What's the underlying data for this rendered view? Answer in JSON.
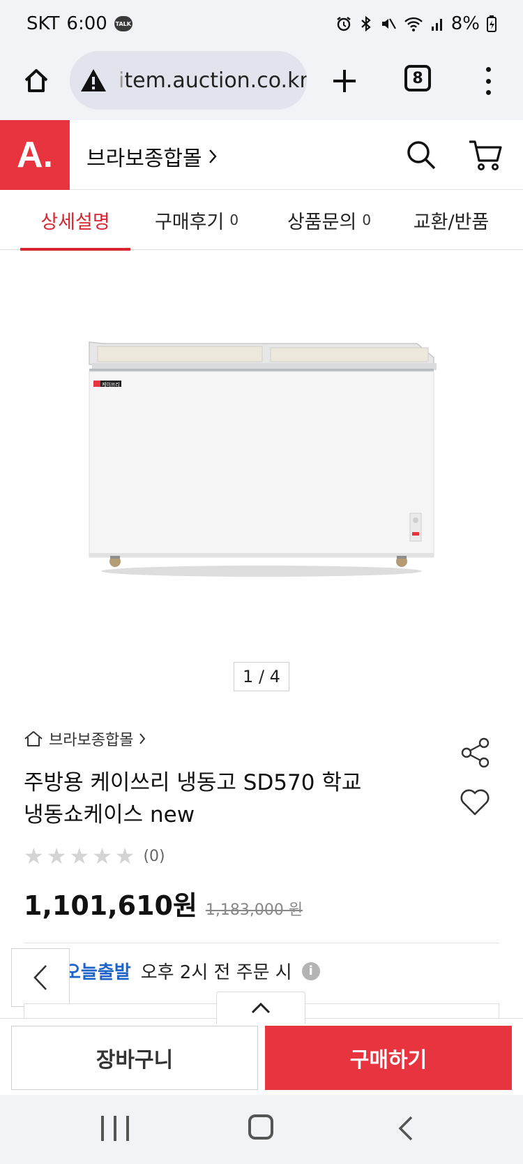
{
  "status_bar": {
    "carrier": "SKT",
    "time": "6:00",
    "talk_badge": "TALK",
    "battery": "8%"
  },
  "browser": {
    "url_dim_prefix": "i",
    "url": "tem.auction.co.kr",
    "tab_count": "8"
  },
  "header": {
    "logo": "A.",
    "store_name": "브라보종합몰",
    "chevron": "›"
  },
  "tabs": [
    {
      "label": "상세설명",
      "count": ""
    },
    {
      "label": "구매후기",
      "count": "0"
    },
    {
      "label": "상품문의",
      "count": "0"
    },
    {
      "label": "교환/반품",
      "count": ""
    }
  ],
  "gallery": {
    "indicator": "1 / 4",
    "product_label": "케이쓰리"
  },
  "product": {
    "store_breadcrumb": "브라보종합몰",
    "title_line1": "주방용 케이쓰리 냉동고 SD570 학교",
    "title_line2": "냉동쇼케이스 new",
    "rating_value": 0,
    "rating_max": 5,
    "review_count": "(0)",
    "price": "1,101,610원",
    "original_price": "1,183,000 원"
  },
  "shipping": {
    "today_label": "오늘출발",
    "info": "오후 2시 전 주문 시",
    "info_icon": "i"
  },
  "actions": {
    "cart_label": "장바구니",
    "buy_label": "구매하기"
  },
  "colors": {
    "brand": "#e8343f",
    "active_tab": "#d8252f",
    "shipping_blue": "#1e63c8"
  }
}
